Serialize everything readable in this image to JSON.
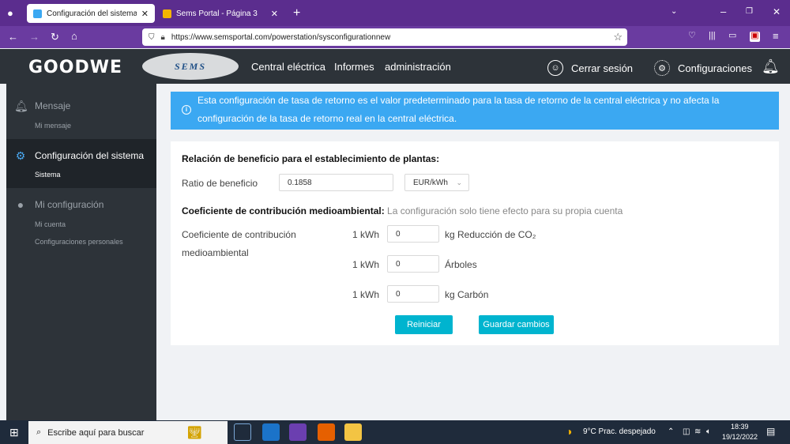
{
  "browser": {
    "tabs": [
      {
        "label": "Configuración del sistema - SEMS",
        "active": true
      },
      {
        "label": "Sems Portal - Página 3",
        "active": false
      }
    ],
    "url": "https://www.semsportal.com/powerstation/sysconfigurationnew"
  },
  "header": {
    "logo": "GOODWE",
    "sems_logo": "SEMS",
    "nav": [
      "Central eléctrica",
      "Informes",
      "administración"
    ],
    "logout": "Cerrar sesión",
    "settings": "Configuraciones"
  },
  "sidebar": {
    "groups": [
      {
        "title": "Mensaje",
        "icon": "bell-icon",
        "items": [
          "Mi mensaje"
        ]
      },
      {
        "title": "Configuración del sistema",
        "icon": "gear-icon",
        "items": [
          "Sistema"
        ],
        "active": true
      },
      {
        "title": "Mi configuración",
        "icon": "user-icon",
        "items": [
          "Mi cuenta",
          "Configuraciones personales"
        ]
      }
    ]
  },
  "alert": {
    "text": "Esta configuración de tasa de retorno es el valor predeterminado para la tasa de retorno de la central eléctrica y no afecta la configuración de la tasa de retorno real en la central eléctrica."
  },
  "form": {
    "section1_title": "Relación de beneficio para el establecimiento de plantas:",
    "ratio_label": "Ratio de beneficio",
    "ratio_value": "0.1858",
    "unit_value": "EUR/kWh",
    "section2_title": "Coeficiente de contribución medioambiental:",
    "section2_hint": "La configuración solo tiene efecto para su propia cuenta",
    "coef_label": "Coeficiente de contribución medioambiental",
    "rows": [
      {
        "prefix": "1 kWh",
        "value": "0",
        "suffix": "kg Reducción de CO₂"
      },
      {
        "prefix": "1 kWh",
        "value": "0",
        "suffix": "Árboles"
      },
      {
        "prefix": "1 kWh",
        "value": "0",
        "suffix": "kg Carbón"
      }
    ],
    "reset_label": "Reiniciar",
    "save_label": "Guardar cambios"
  },
  "taskbar": {
    "search_placeholder": "Escribe aquí para buscar",
    "weather": "9°C  Prac. despejado",
    "time": "18:39",
    "date": "19/12/2022"
  },
  "colors": {
    "accent": "#00b4cf",
    "alert": "#3ba8f2",
    "header_bg": "#2d3339",
    "browser_bg": "#5b2d8e"
  }
}
